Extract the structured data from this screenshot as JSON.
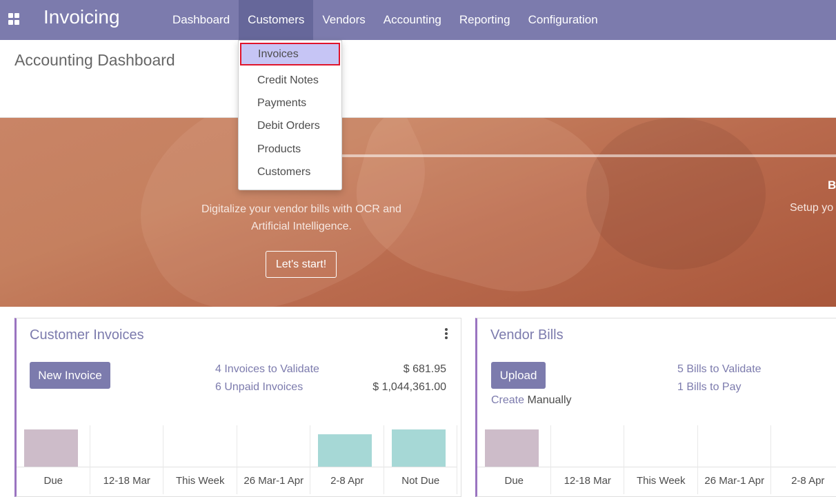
{
  "navbar": {
    "app_name": "Invoicing",
    "menu": [
      "Dashboard",
      "Customers",
      "Vendors",
      "Accounting",
      "Reporting",
      "Configuration"
    ],
    "active": "Customers"
  },
  "page": {
    "breadcrumb": "Accounting Dashboard"
  },
  "dropdown": {
    "items": [
      "Invoices",
      "Credit Notes",
      "Payments",
      "Debit Orders",
      "Products",
      "Customers"
    ],
    "highlighted": "Invoices"
  },
  "banner": {
    "text": "Digitalize your vendor bills with OCR and Artificial Intelligence.",
    "button": "Let's start!",
    "right_title": "B",
    "right_text": "Setup yo"
  },
  "customer_card": {
    "title": "Customer Invoices",
    "button": "New Invoice",
    "links": [
      {
        "label": "4 Invoices to Validate",
        "amount": "$ 681.95"
      },
      {
        "label": "6 Unpaid Invoices",
        "amount": "$ 1,044,361.00"
      }
    ],
    "chart_data": {
      "type": "bar",
      "categories": [
        "Due",
        "12-18 Mar",
        "This Week",
        "26 Mar-1 Apr",
        "2-8 Apr",
        "Not Due"
      ],
      "bars": [
        {
          "category": "Due",
          "level": 0.95,
          "color": "#cdbcc9"
        },
        {
          "category": "12-18 Mar",
          "level": 0,
          "color": "#cdbcc9"
        },
        {
          "category": "This Week",
          "level": 0,
          "color": "#cdbcc9"
        },
        {
          "category": "26 Mar-1 Apr",
          "level": 0,
          "color": "#cdbcc9"
        },
        {
          "category": "2-8 Apr",
          "level": 0.82,
          "color": "#a6d8d6"
        },
        {
          "category": "Not Due",
          "level": 0.95,
          "color": "#a6d8d6"
        }
      ]
    }
  },
  "vendor_card": {
    "title": "Vendor Bills",
    "button": "Upload",
    "create": "Create",
    "manually": "Manually",
    "links": [
      "5 Bills to Validate",
      "1 Bills to Pay"
    ],
    "chart_data": {
      "type": "bar",
      "categories": [
        "Due",
        "12-18 Mar",
        "This Week",
        "26 Mar-1 Apr",
        "2-8 Apr"
      ],
      "bars": [
        {
          "category": "Due",
          "level": 0.95,
          "color": "#cdbcc9"
        },
        {
          "category": "12-18 Mar",
          "level": 0,
          "color": "#cdbcc9"
        },
        {
          "category": "This Week",
          "level": 0,
          "color": "#cdbcc9"
        },
        {
          "category": "26 Mar-1 Apr",
          "level": 0,
          "color": "#cdbcc9"
        },
        {
          "category": "2-8 Apr",
          "level": 0,
          "color": "#cdbcc9"
        }
      ]
    }
  },
  "colors": {
    "brand": "#7c7bad",
    "highlight_border": "#e0142b",
    "highlight_fill": "#c6c5f5"
  }
}
